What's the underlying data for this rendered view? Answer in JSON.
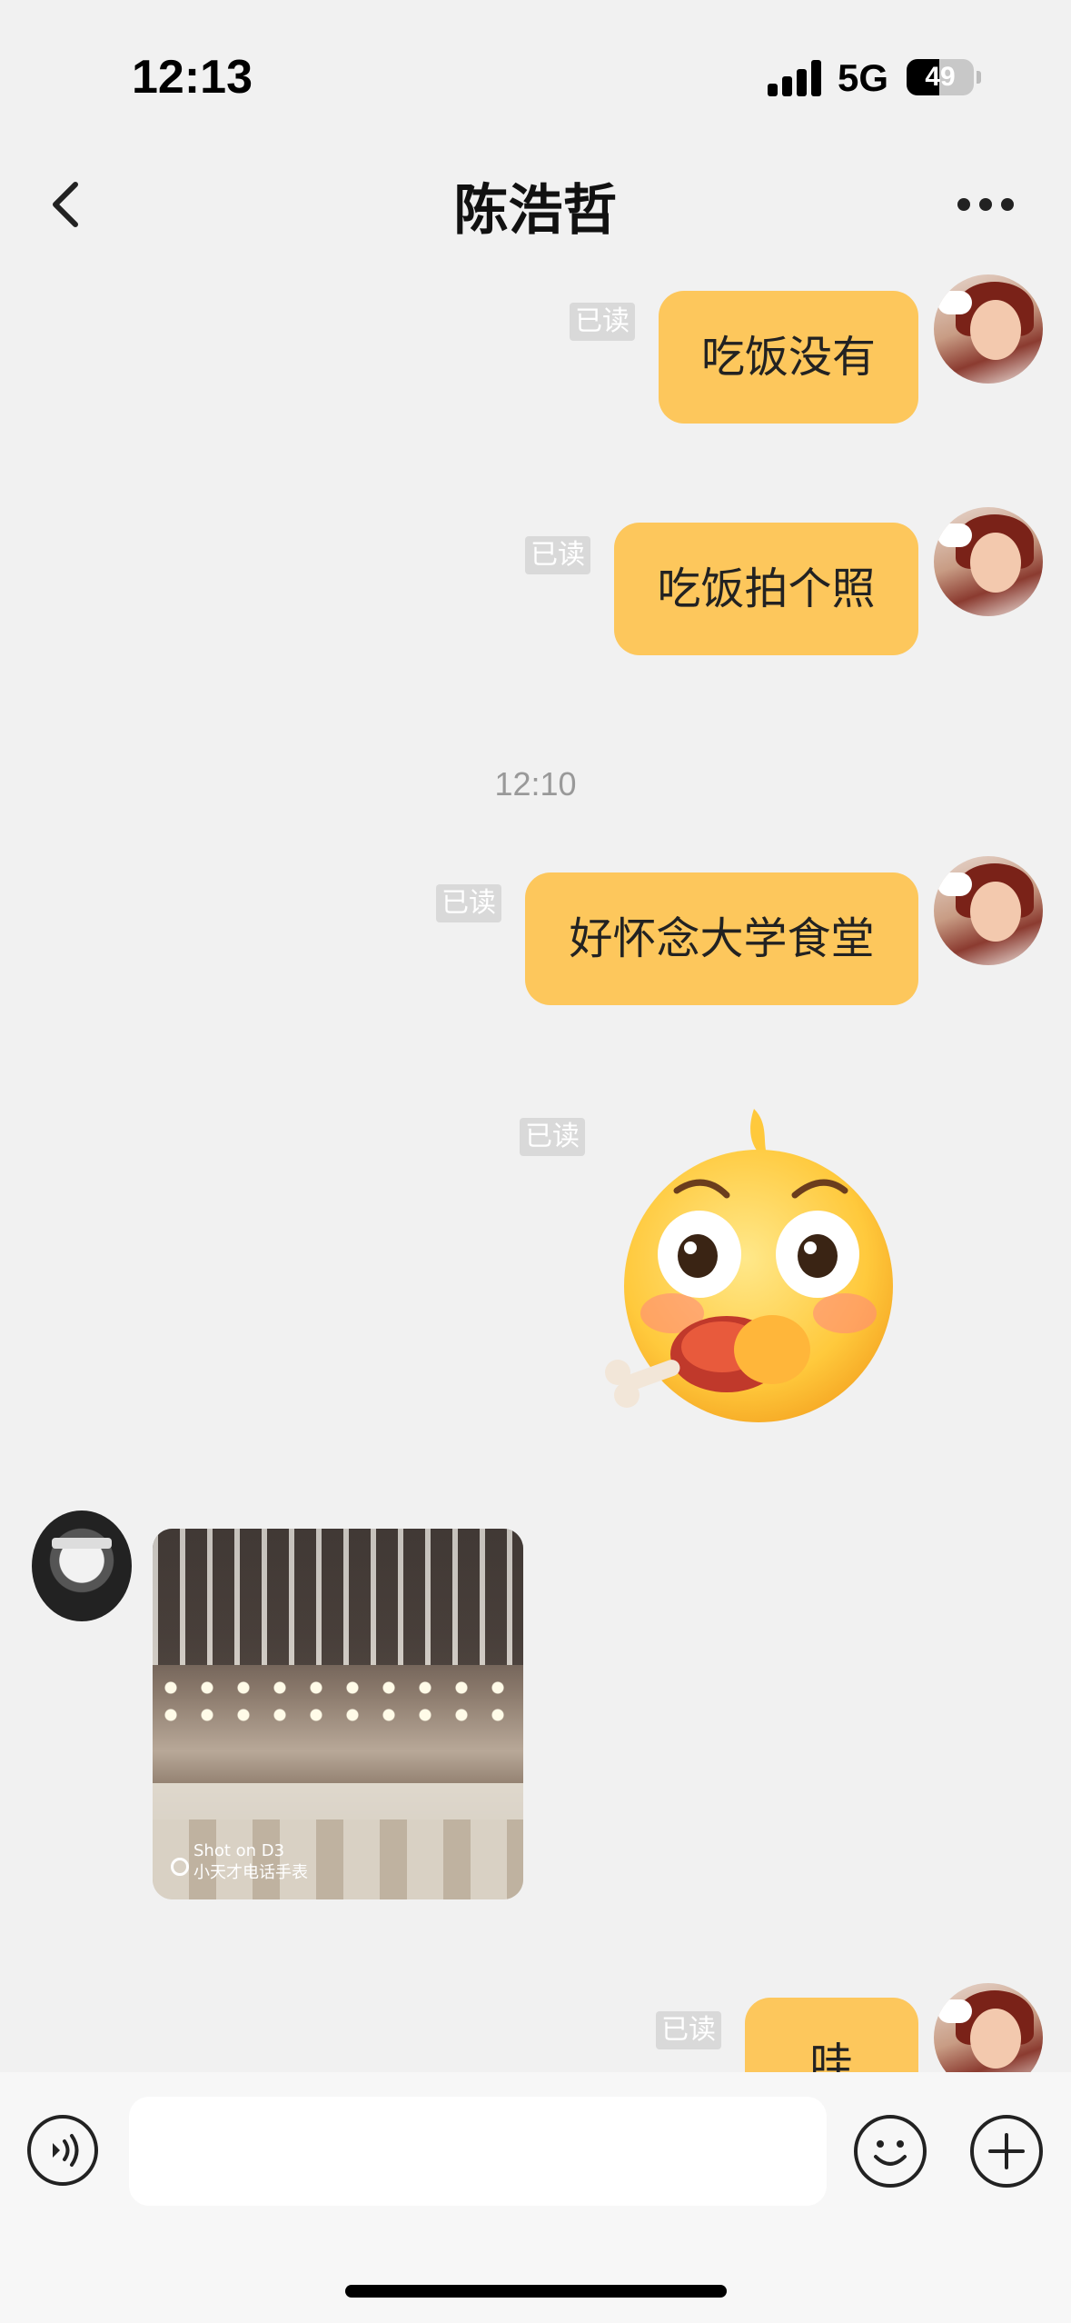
{
  "status_bar": {
    "time": "12:13",
    "network": "5G",
    "battery": "49"
  },
  "header": {
    "title": "陈浩哲"
  },
  "messages": [
    {
      "text": "吃饭没有",
      "read": "已读"
    },
    {
      "text": "吃饭拍个照",
      "read": "已读"
    },
    {
      "timestamp": "12:10"
    },
    {
      "text": "好怀念大学食堂",
      "read": "已读"
    },
    {
      "read": "已读",
      "sticker": "chick-eating-drumstick-sticker"
    },
    {
      "photo": {
        "caption_line1": "Shot on D3",
        "caption_line2": "小天才电话手表"
      }
    },
    {
      "text": "哇",
      "read": "已读"
    }
  ],
  "input": {
    "placeholder": ""
  },
  "colors": {
    "bubble": "#fdc75c",
    "background": "#f1f1f1"
  }
}
